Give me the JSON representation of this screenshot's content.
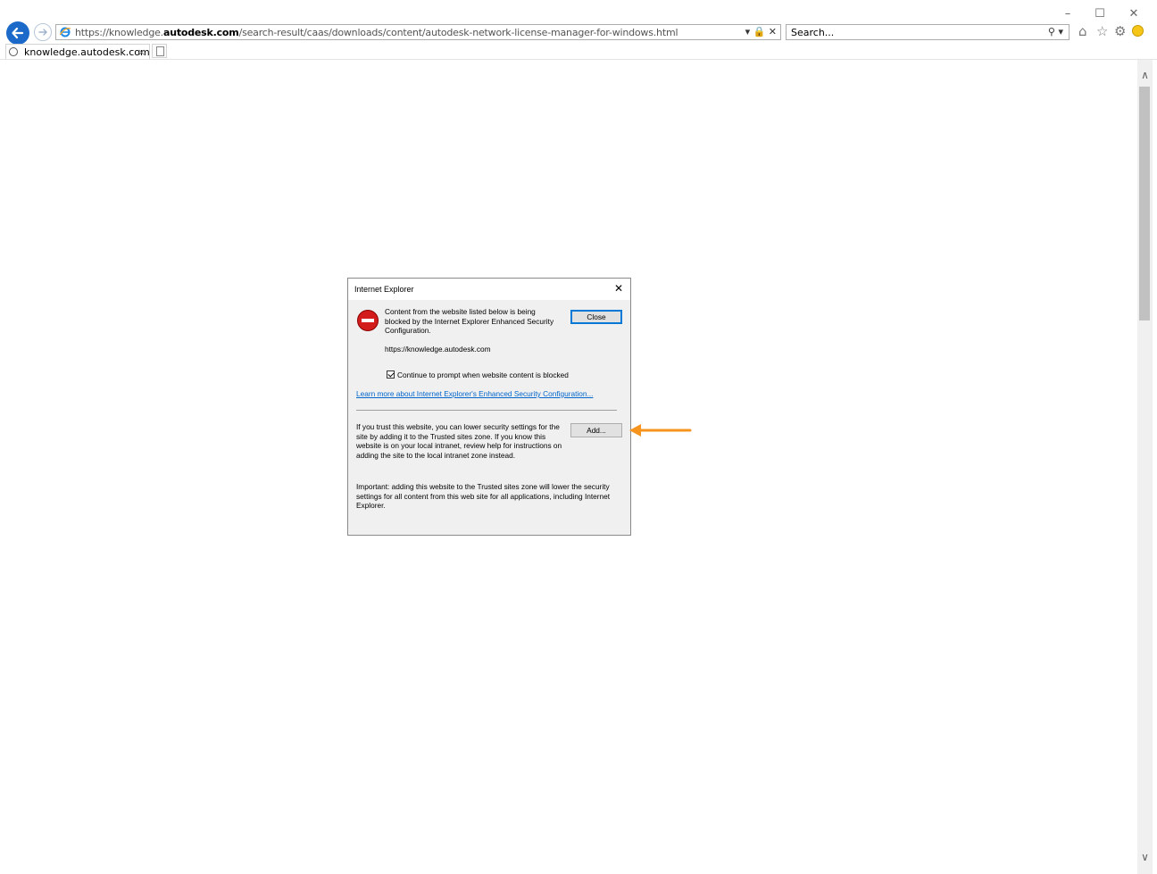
{
  "browser": {
    "window_controls": {
      "minimize": "–",
      "maximize": "☐",
      "close": "✕"
    },
    "address": {
      "url_prefix": "https://",
      "url_sub": "knowledge.",
      "url_host": "autodesk.com",
      "url_path": "/search-result/caas/downloads/content/autodesk-network-license-manager-for-windows.html",
      "controls": "▾ 🔒 ✕"
    },
    "search": {
      "placeholder": "Search...",
      "icon_text": "⚲ ▾"
    },
    "tools": {
      "home": "⌂",
      "favorites": "☆",
      "settings": "⚙"
    },
    "tab": {
      "title": "knowledge.autodesk.com",
      "close": "×"
    },
    "scroll": {
      "up": "∧",
      "down": "∨"
    }
  },
  "dialog": {
    "title": "Internet Explorer",
    "close_glyph": "✕",
    "message": "Content from the website listed below is being blocked by the Internet Explorer Enhanced Security Configuration.",
    "site": "https://knowledge.autodesk.com",
    "close_button": "Close",
    "checkbox_label": "Continue to prompt when website content is blocked",
    "checkbox_checked": true,
    "learn_more_link": "Learn more about Internet Explorer's Enhanced Security Configuration...",
    "trust_text": "If you trust this website, you can lower security settings for the site by adding it to the Trusted sites zone. If you know this website is on your local intranet, review help for instructions on adding the site to the local intranet zone instead.",
    "add_button": "Add...",
    "important_text": "Important: adding this website to the Trusted sites zone will lower the security settings for all content from this web site for all applications, including Internet Explorer."
  },
  "colors": {
    "back_button": "#1b6ac9",
    "annotation_arrow": "#f7941d",
    "link": "#0066cc"
  }
}
